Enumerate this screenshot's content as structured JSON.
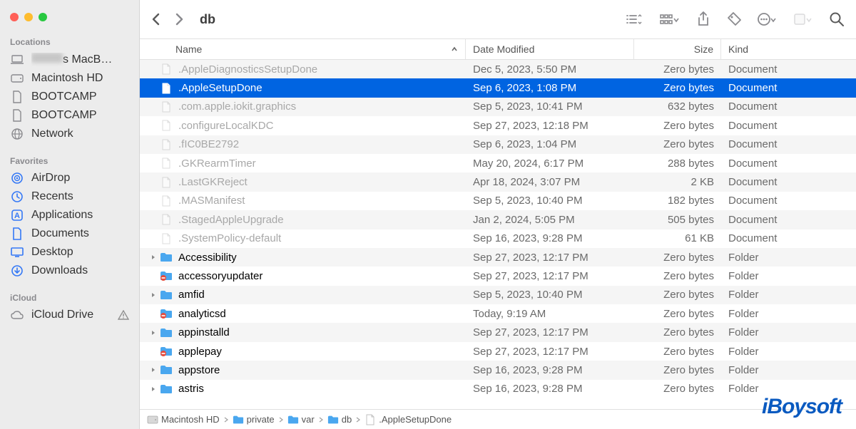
{
  "window_title": "db",
  "sidebar": {
    "sections": [
      {
        "title": "Locations",
        "items": [
          {
            "icon": "laptop",
            "label": "s MacB…",
            "blurredPrefix": true
          },
          {
            "icon": "hdd",
            "label": "Macintosh HD"
          },
          {
            "icon": "doc",
            "label": "BOOTCAMP"
          },
          {
            "icon": "doc",
            "label": "BOOTCAMP"
          },
          {
            "icon": "globe",
            "label": "Network"
          }
        ]
      },
      {
        "title": "Favorites",
        "items": [
          {
            "icon": "airdrop",
            "label": "AirDrop"
          },
          {
            "icon": "clock",
            "label": "Recents"
          },
          {
            "icon": "apps",
            "label": "Applications"
          },
          {
            "icon": "docfile",
            "label": "Documents"
          },
          {
            "icon": "desktop",
            "label": "Desktop"
          },
          {
            "icon": "download",
            "label": "Downloads"
          }
        ]
      },
      {
        "title": "iCloud",
        "items": [
          {
            "icon": "cloud",
            "label": "iCloud Drive",
            "warn": true
          }
        ]
      }
    ]
  },
  "columns": {
    "name": "Name",
    "date": "Date Modified",
    "size": "Size",
    "kind": "Kind"
  },
  "rows": [
    {
      "name": ".AppleDiagnosticsSetupDone",
      "date": "Dec 5, 2023, 5:50 PM",
      "size": "Zero bytes",
      "kind": "Document",
      "type": "file",
      "dimmed": true
    },
    {
      "name": ".AppleSetupDone",
      "date": "Sep 6, 2023, 1:08 PM",
      "size": "Zero bytes",
      "kind": "Document",
      "type": "file",
      "selected": true
    },
    {
      "name": ".com.apple.iokit.graphics",
      "date": "Sep 5, 2023, 10:41 PM",
      "size": "632 bytes",
      "kind": "Document",
      "type": "file",
      "dimmed": true
    },
    {
      "name": ".configureLocalKDC",
      "date": "Sep 27, 2023, 12:18 PM",
      "size": "Zero bytes",
      "kind": "Document",
      "type": "file",
      "dimmed": true
    },
    {
      "name": ".fIC0BE2792",
      "date": "Sep 6, 2023, 1:04 PM",
      "size": "Zero bytes",
      "kind": "Document",
      "type": "file",
      "dimmed": true
    },
    {
      "name": ".GKRearmTimer",
      "date": "May 20, 2024, 6:17 PM",
      "size": "288 bytes",
      "kind": "Document",
      "type": "file",
      "dimmed": true
    },
    {
      "name": ".LastGKReject",
      "date": "Apr 18, 2024, 3:07 PM",
      "size": "2 KB",
      "kind": "Document",
      "type": "file",
      "dimmed": true
    },
    {
      "name": ".MASManifest",
      "date": "Sep 5, 2023, 10:40 PM",
      "size": "182 bytes",
      "kind": "Document",
      "type": "file",
      "dimmed": true
    },
    {
      "name": ".StagedAppleUpgrade",
      "date": "Jan 2, 2024, 5:05 PM",
      "size": "505 bytes",
      "kind": "Document",
      "type": "file",
      "dimmed": true
    },
    {
      "name": ".SystemPolicy-default",
      "date": "Sep 16, 2023, 9:28 PM",
      "size": "61 KB",
      "kind": "Document",
      "type": "file",
      "dimmed": true
    },
    {
      "name": "Accessibility",
      "date": "Sep 27, 2023, 12:17 PM",
      "size": "Zero bytes",
      "kind": "Folder",
      "type": "folder",
      "disclosure": true
    },
    {
      "name": "accessoryupdater",
      "date": "Sep 27, 2023, 12:17 PM",
      "size": "Zero bytes",
      "kind": "Folder",
      "type": "folder",
      "restricted": true
    },
    {
      "name": "amfid",
      "date": "Sep 5, 2023, 10:40 PM",
      "size": "Zero bytes",
      "kind": "Folder",
      "type": "folder",
      "disclosure": true
    },
    {
      "name": "analyticsd",
      "date": "Today, 9:19 AM",
      "size": "Zero bytes",
      "kind": "Folder",
      "type": "folder",
      "restricted": true
    },
    {
      "name": "appinstalld",
      "date": "Sep 27, 2023, 12:17 PM",
      "size": "Zero bytes",
      "kind": "Folder",
      "type": "folder",
      "disclosure": true
    },
    {
      "name": "applepay",
      "date": "Sep 27, 2023, 12:17 PM",
      "size": "Zero bytes",
      "kind": "Folder",
      "type": "folder",
      "restricted": true
    },
    {
      "name": "appstore",
      "date": "Sep 16, 2023, 9:28 PM",
      "size": "Zero bytes",
      "kind": "Folder",
      "type": "folder",
      "disclosure": true
    },
    {
      "name": "astris",
      "date": "Sep 16, 2023, 9:28 PM",
      "size": "Zero bytes",
      "kind": "Folder",
      "type": "folder",
      "disclosure": true
    }
  ],
  "pathbar": [
    {
      "icon": "hdd",
      "label": "Macintosh HD"
    },
    {
      "icon": "folder",
      "label": "private"
    },
    {
      "icon": "folder",
      "label": "var"
    },
    {
      "icon": "folder",
      "label": "db"
    },
    {
      "icon": "file",
      "label": ".AppleSetupDone"
    }
  ],
  "watermark": "iBoysoft"
}
